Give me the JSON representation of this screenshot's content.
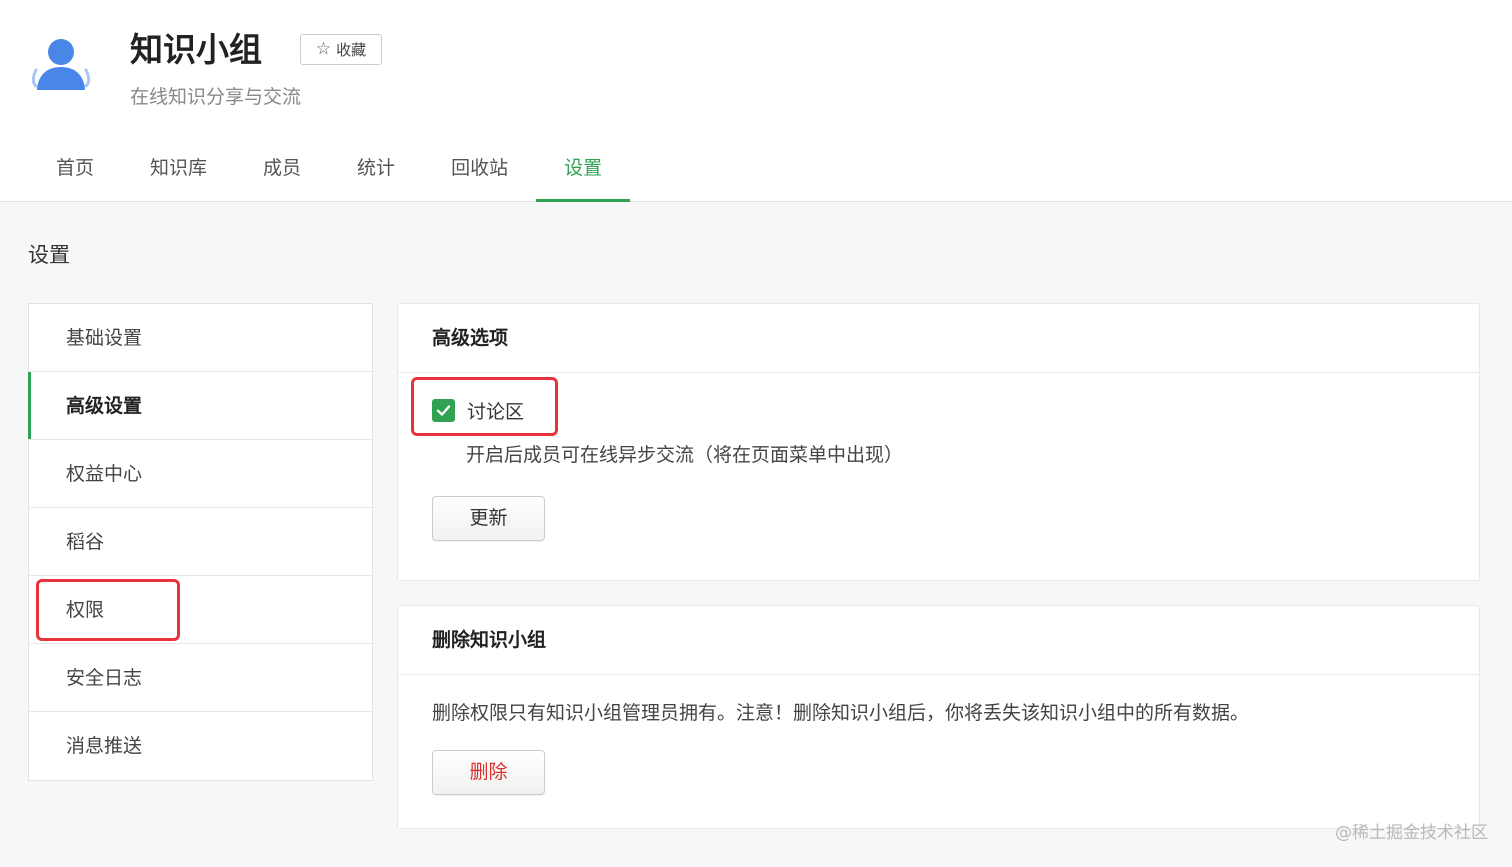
{
  "header": {
    "group_name": "知识小组",
    "favorite_label": "收藏",
    "subtitle": "在线知识分享与交流",
    "tabs": [
      {
        "label": "首页"
      },
      {
        "label": "知识库"
      },
      {
        "label": "成员"
      },
      {
        "label": "统计"
      },
      {
        "label": "回收站"
      },
      {
        "label": "设置",
        "active": true
      }
    ]
  },
  "settings": {
    "title": "设置",
    "menu": [
      {
        "label": "基础设置"
      },
      {
        "label": "高级设置",
        "active": true
      },
      {
        "label": "权益中心"
      },
      {
        "label": "稻谷"
      },
      {
        "label": "权限"
      },
      {
        "label": "安全日志"
      },
      {
        "label": "消息推送"
      }
    ]
  },
  "advanced": {
    "title": "高级选项",
    "discussion_label": "讨论区",
    "discussion_checked": true,
    "discussion_desc": "开启后成员可在线异步交流（将在页面菜单中出现）",
    "update_button": "更新"
  },
  "delete_group": {
    "title": "删除知识小组",
    "description": "删除权限只有知识小组管理员拥有。注意！删除知识小组后，你将丢失该知识小组中的所有数据。",
    "delete_button": "删除"
  },
  "watermark": "@稀土掘金技术社区",
  "colors": {
    "accent": "#2fa352",
    "danger": "#d9302c",
    "highlight": "#e8333c",
    "avatar": "#4a86e8"
  }
}
